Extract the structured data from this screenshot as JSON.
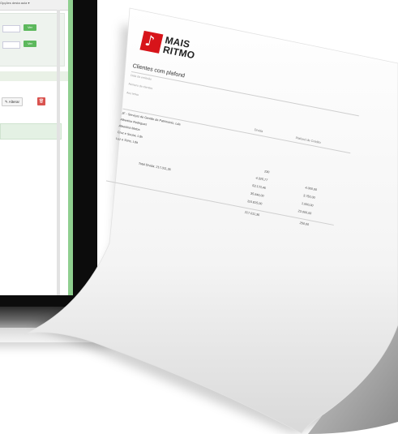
{
  "laptop": {
    "header_link": "Opções desta aula ▾",
    "form_buttons": [
      "Ver",
      "Ver"
    ],
    "alterar_label": "Alterar",
    "delete_icon": "trash-icon",
    "edit_icon": "pencil-icon"
  },
  "document": {
    "logo": {
      "line1": "MAIS",
      "line2": "RITMO",
      "brand_color": "#d7141a",
      "icon": "music-note-icon"
    },
    "title": "Clientes com plafond",
    "meta_lines": [
      "Data da emissão",
      "Número de clientes",
      "Ano letivo"
    ],
    "columns": {
      "debt": "Dívida",
      "plafond": "Plafond de Crédito"
    },
    "rows": [
      {
        "name": "JF - Serviços de Gestão de Património, Lda",
        "debt": "",
        "plafond": ""
      },
      {
        "name": "Albertino Rodrigues",
        "debt": "230",
        "plafond": ""
      },
      {
        "name": "Albertina Matos",
        "debt": "4.325,77",
        "plafond": "4.000,00"
      },
      {
        "name": "Cruz e Sousa, Lda",
        "debt": "53.170,46",
        "plafond": "3.750,00"
      },
      {
        "name": "Luz e Sons, Lda",
        "debt": "35.646,00",
        "plafond": "1.000,00"
      },
      {
        "name": "",
        "debt": "116.815,00",
        "plafond": "23.000,00"
      }
    ],
    "total_label": "Total Dívida: 217.011,36",
    "total_debt": "217.011,36",
    "total_plafond": "250,00"
  }
}
